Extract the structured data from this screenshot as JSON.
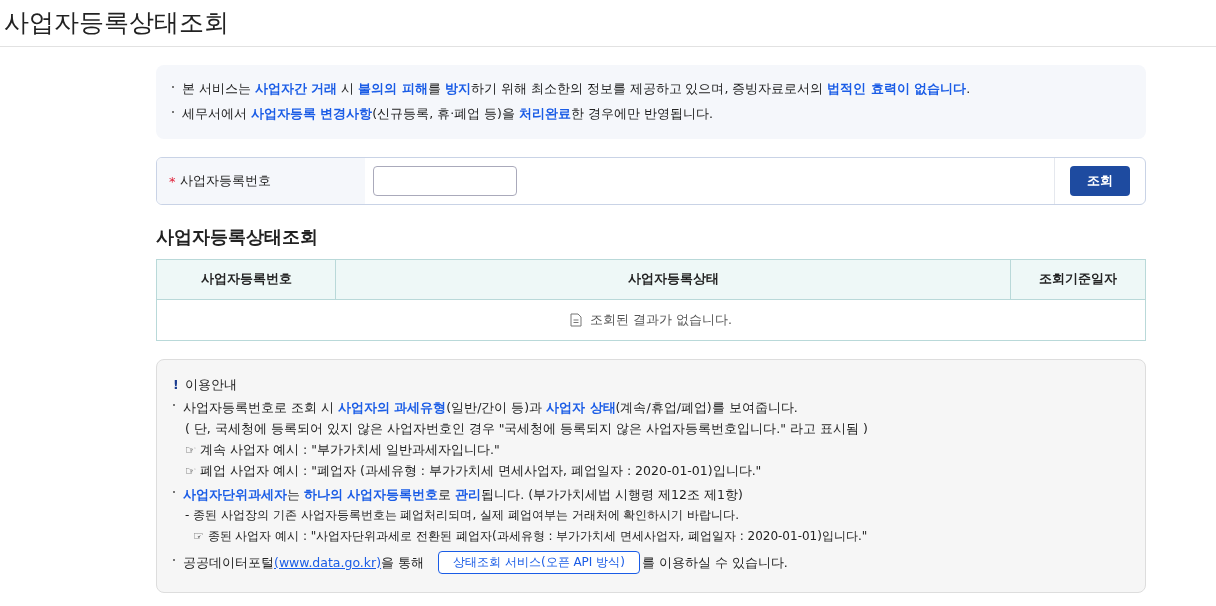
{
  "page_title": "사업자등록상태조회",
  "notice": [
    "본 서비스는 **사업자간 거래** 시 **불의의 피해**를 **방지**하기 위해 최소한의 정보를 제공하고 있으며, 증빙자료로서의 **법적인 효력이 없습니다**.",
    "세무서에서 **사업자등록 변경사항**(신규등록, 휴·폐업 등)을 **처리완료**한 경우에만 반영됩니다."
  ],
  "search": {
    "label": "사업자등록번호",
    "required_mark": "*",
    "button": "조회"
  },
  "result": {
    "title": "사업자등록상태조회",
    "columns": [
      "사업자등록번호",
      "사업자등록상태",
      "조회기준일자"
    ],
    "empty_message": "조회된 결과가 없습니다."
  },
  "guide": {
    "mark": "!",
    "title": "이용안내",
    "items": [
      {
        "kind": "bullet",
        "text": "사업자등록번호로 조회 시 **사업자의 과세유형**(일반/간이 등)과 **사업자 상태**(계속/휴업/폐업)를 보여줍니다.",
        "lines": [
          "( 단, 국세청에 등록되어 있지 않은 사업자번호인 경우 \"국세청에 등록되지 않은 사업자등록번호입니다.\" 라고 표시됨 )",
          "☞ 계속 사업자 예시 : \"부가가치세 일반과세자입니다.\"",
          "☞ 폐업 사업자 예시 : \"폐업자 (과세유형 : 부가가치세 면세사업자, 폐업일자 : 2020-01-01)입니다.\""
        ]
      },
      {
        "kind": "bullet",
        "text": "**사업자단위과세자**는 **하나의 사업자등록번호**로 **관리**됩니다. (부가가치세법 시행령 제12조 제1항)",
        "lines": [
          "- 종된 사업장의 기존 사업자등록번호는 폐업처리되며, 실제 폐업여부는 거래처에 확인하시기 바랍니다.",
          "☞ 종된 사업자 예시 : \"사업자단위과세로 전환된 폐업자(과세유형 : 부가가치세 면세사업자, 폐업일자 : 2020-01-01)입니다.\""
        ]
      },
      {
        "kind": "link_line",
        "before": "공공데이터포털",
        "link": "(www.data.go.kr)",
        "middle": "을 통해",
        "button": "상태조회 서비스(오픈 API 방식)",
        "after": "를 이용하실 수 있습니다."
      }
    ]
  }
}
